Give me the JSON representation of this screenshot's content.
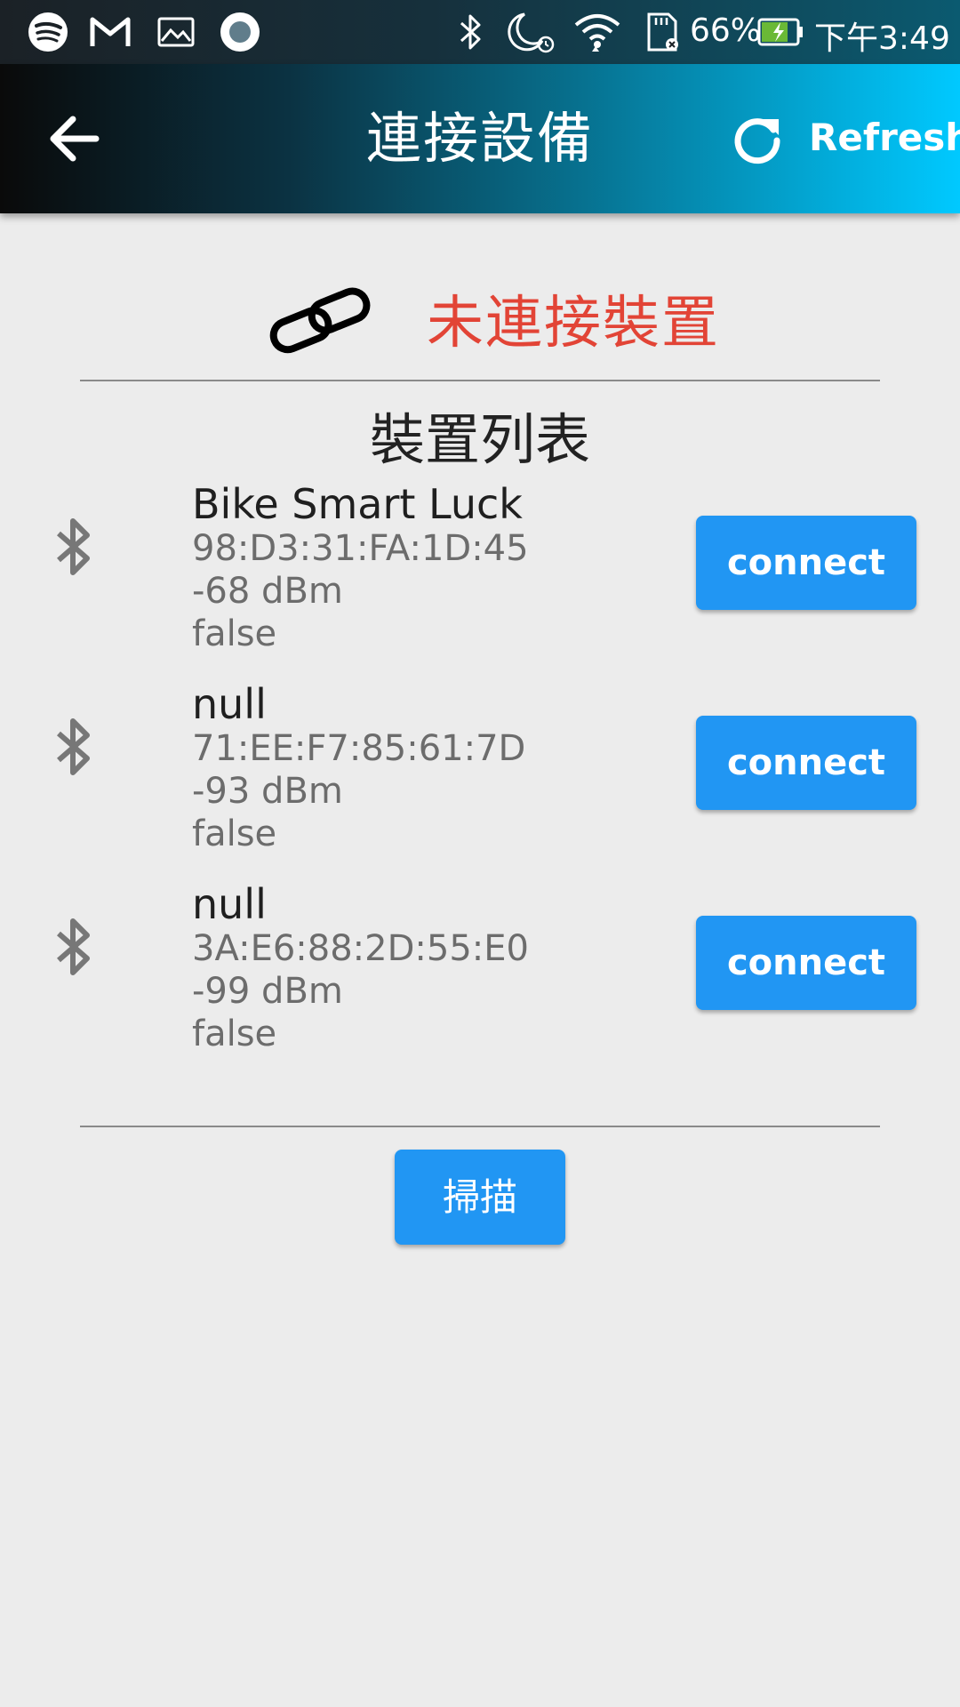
{
  "status_bar": {
    "battery_percent": "66%",
    "time": "下午3:49",
    "icons": [
      "spotify-icon",
      "gmail-icon",
      "gallery-icon",
      "record-icon",
      "bluetooth-icon",
      "do-not-disturb-alarm-icon",
      "wifi-icon",
      "sd-card-icon",
      "battery-charging-icon"
    ]
  },
  "app_bar": {
    "title": "連接設備",
    "refresh_label": "Refresh"
  },
  "connection": {
    "status_text": "未連接裝置",
    "status_color": "#e24436"
  },
  "device_list": {
    "title": "裝置列表",
    "devices": [
      {
        "name": "Bike Smart Luck",
        "address": "98:D3:31:FA:1D:45",
        "rssi": "-68 dBm",
        "connected": "false",
        "button_label": "connect"
      },
      {
        "name": "null",
        "address": "71:EE:F7:85:61:7D",
        "rssi": "-93 dBm",
        "connected": "false",
        "button_label": "connect"
      },
      {
        "name": "null",
        "address": "3A:E6:88:2D:55:E0",
        "rssi": "-99 dBm",
        "connected": "false",
        "button_label": "connect"
      }
    ]
  },
  "scan_button": {
    "label": "掃描"
  },
  "colors": {
    "accent": "#2196f3",
    "background": "#ececec"
  }
}
